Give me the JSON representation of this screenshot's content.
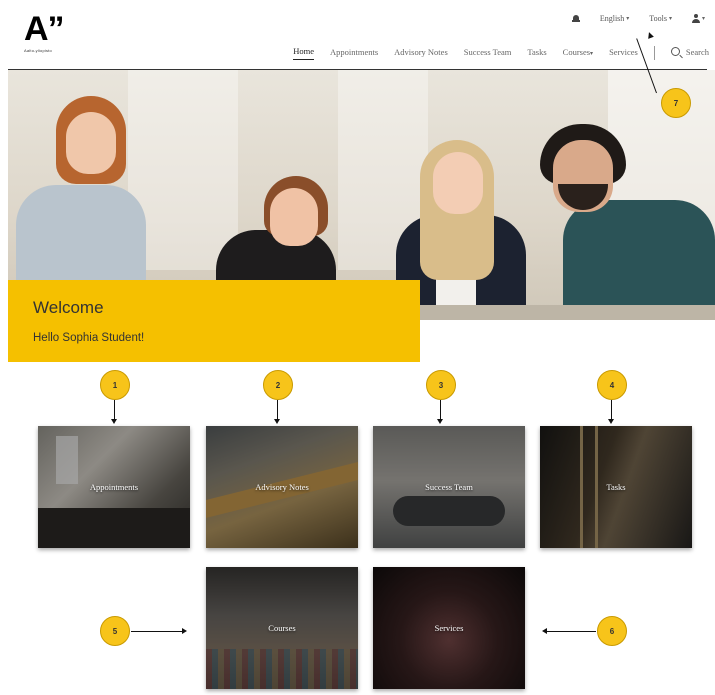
{
  "logo": {
    "mark": "A”",
    "subtitle": "Aalto-yliopisto"
  },
  "top_bar": {
    "language": "English",
    "tools": "Tools"
  },
  "nav": {
    "items": [
      "Home",
      "Appointments",
      "Advisory Notes",
      "Success Team",
      "Tasks",
      "Courses",
      "Services"
    ],
    "search_label": "Search"
  },
  "welcome": {
    "title": "Welcome",
    "greeting": "Hello Sophia Student!"
  },
  "tiles": [
    {
      "label": "Appointments"
    },
    {
      "label": "Advisory Notes"
    },
    {
      "label": "Success Team"
    },
    {
      "label": "Tasks"
    },
    {
      "label": "Courses"
    },
    {
      "label": "Services"
    }
  ],
  "callouts": [
    "1",
    "2",
    "3",
    "4",
    "5",
    "6",
    "7"
  ],
  "colors": {
    "accent": "#f5c000",
    "callout": "#f7c41a",
    "text": "#333333"
  },
  "icons": [
    "bell-icon",
    "user-icon",
    "search-icon",
    "chevron-down-icon"
  ]
}
